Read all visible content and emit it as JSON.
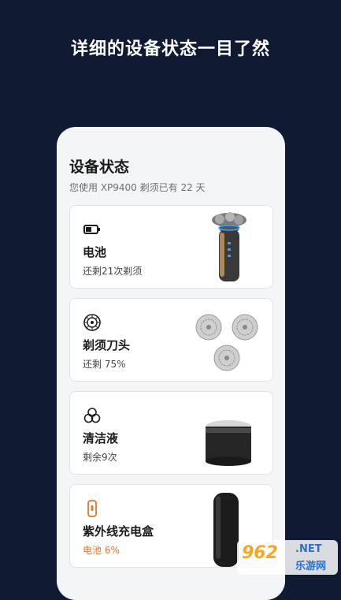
{
  "headline": "详细的设备状态一目了然",
  "screen": {
    "title": "设备状态",
    "subtitle": "您使用 XP9400 剃须已有 22 天"
  },
  "cards": [
    {
      "name": "电池",
      "status": "还剩21次剃须",
      "icon": "battery-icon",
      "image": "shaver-image"
    },
    {
      "name": "剃须刀头",
      "status": "还剩 75%",
      "icon": "shaving-head-icon",
      "image": "shaving-heads-image"
    },
    {
      "name": "清洁液",
      "status": "剩余9次",
      "icon": "cleaning-fluid-icon",
      "image": "cleaning-cartridge-image"
    },
    {
      "name": "紫外线充电盒",
      "status": "电池 6%",
      "icon": "uv-case-icon",
      "image": "uv-case-image",
      "status_color": "#e8742a"
    }
  ],
  "watermark": {
    "brand": "962",
    "domain": ".NET",
    "cn": "乐游网"
  },
  "colors": {
    "background": "#111a33",
    "accent_warning": "#e8742a",
    "card": "#ffffff"
  }
}
